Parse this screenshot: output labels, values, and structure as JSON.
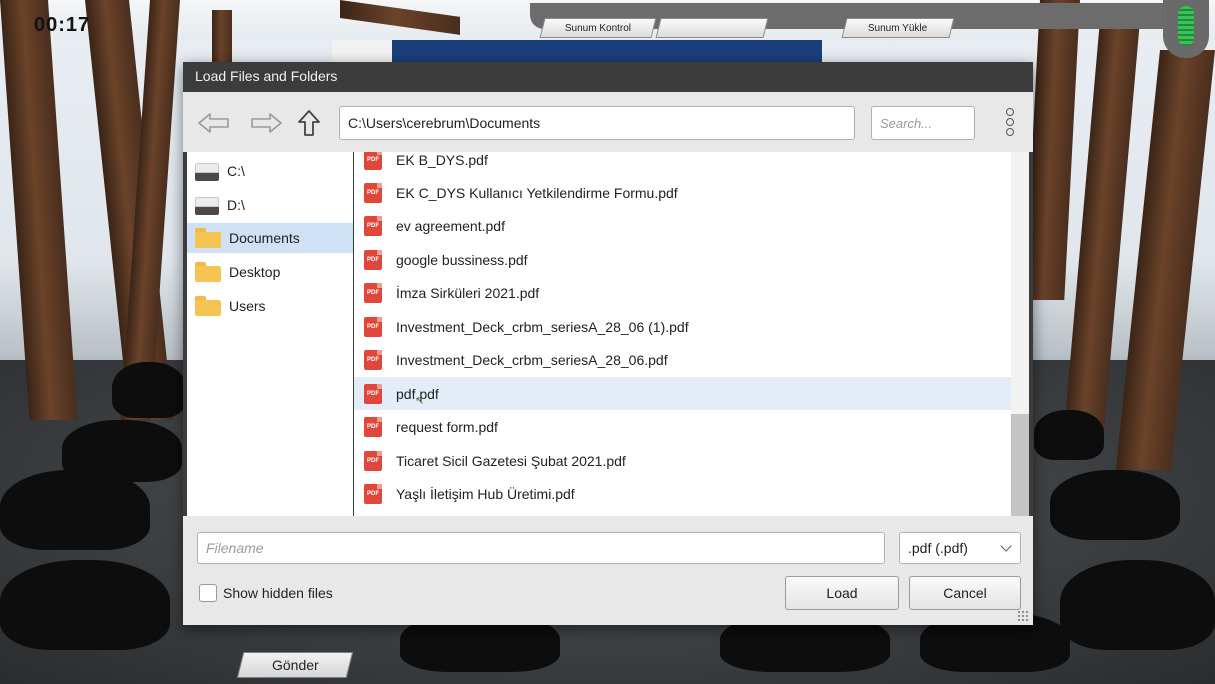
{
  "hud": {
    "timer": "00:17",
    "top_tabs": [
      "Sunum Kontrol",
      "",
      "Sunum Yükle"
    ],
    "send_label": "Gönder"
  },
  "dialog": {
    "title": "Load Files and Folders",
    "path": "C:\\Users\\cerebrum\\Documents",
    "search_placeholder": "Search...",
    "sidebar": [
      {
        "label": "C:\\",
        "icon": "drive-icon",
        "selected": false
      },
      {
        "label": "D:\\",
        "icon": "drive-icon",
        "selected": false
      },
      {
        "label": "Documents",
        "icon": "folder-icon",
        "selected": true
      },
      {
        "label": "Desktop",
        "icon": "folder-icon",
        "selected": false
      },
      {
        "label": "Users",
        "icon": "folder-icon",
        "selected": false
      }
    ],
    "files": [
      {
        "name": "EK B_DYS.pdf",
        "selected": false
      },
      {
        "name": "EK C_DYS Kullanıcı Yetkilendirme Formu.pdf",
        "selected": false
      },
      {
        "name": "ev agreement.pdf",
        "selected": false
      },
      {
        "name": "google bussiness.pdf",
        "selected": false
      },
      {
        "name": "İmza Sirküleri 2021.pdf",
        "selected": false
      },
      {
        "name": "Investment_Deck_crbm_seriesA_28_06 (1).pdf",
        "selected": false
      },
      {
        "name": "Investment_Deck_crbm_seriesA_28_06.pdf",
        "selected": false
      },
      {
        "name": "pdf.pdf",
        "selected": true
      },
      {
        "name": "request form.pdf",
        "selected": false
      },
      {
        "name": "Ticaret Sicil Gazetesi Şubat 2021.pdf",
        "selected": false
      },
      {
        "name": "Yaşlı İletişim Hub Üretimi.pdf",
        "selected": false
      }
    ],
    "file_icon_text": "PDF",
    "filename_placeholder": "Filename",
    "filter_value": ".pdf (.pdf)",
    "show_hidden_label": "Show hidden files",
    "load_label": "Load",
    "cancel_label": "Cancel"
  },
  "colors": {
    "title_bar": "#3c3c3c",
    "selection": "#cfe1f5",
    "pdf_icon": "#e0463a",
    "folder": "#f6c453",
    "mic_active": "#2fa84a"
  }
}
